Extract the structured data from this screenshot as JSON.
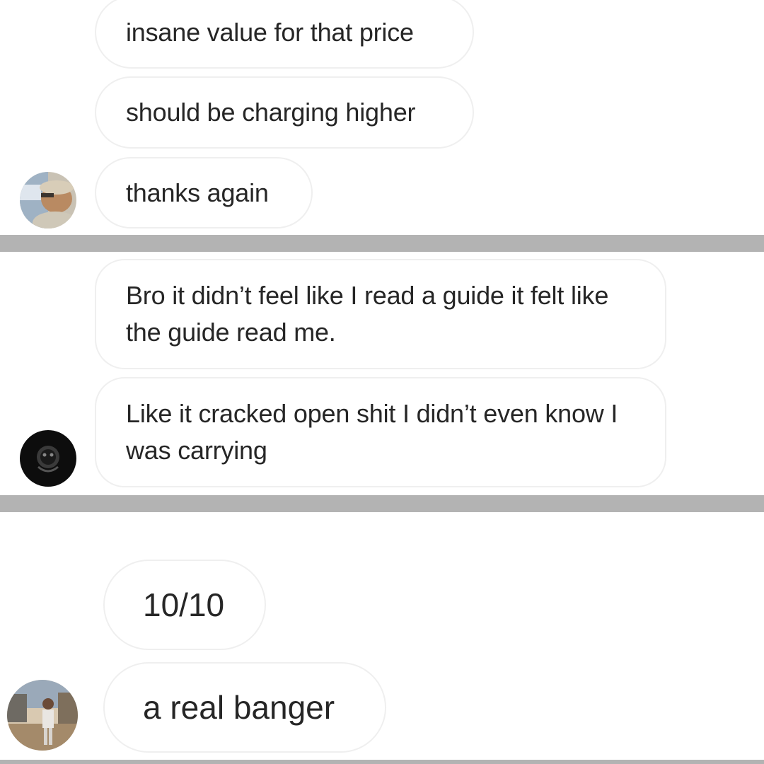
{
  "sections": [
    {
      "messages": [
        {
          "text": "insane value for that price"
        },
        {
          "text": "should be charging higher"
        },
        {
          "text": "thanks again"
        }
      ]
    },
    {
      "messages": [
        {
          "text": "Bro it didn’t feel like I read a guide it felt like the guide read me."
        },
        {
          "text": "Like it cracked open shit I didn’t even know I was carrying"
        }
      ]
    },
    {
      "messages": [
        {
          "text": "10/10"
        },
        {
          "text": "a real banger"
        }
      ]
    }
  ],
  "colors": {
    "bubble_border": "#efefef",
    "text": "#262626",
    "divider": "#b3b3b3",
    "background": "#ffffff"
  }
}
